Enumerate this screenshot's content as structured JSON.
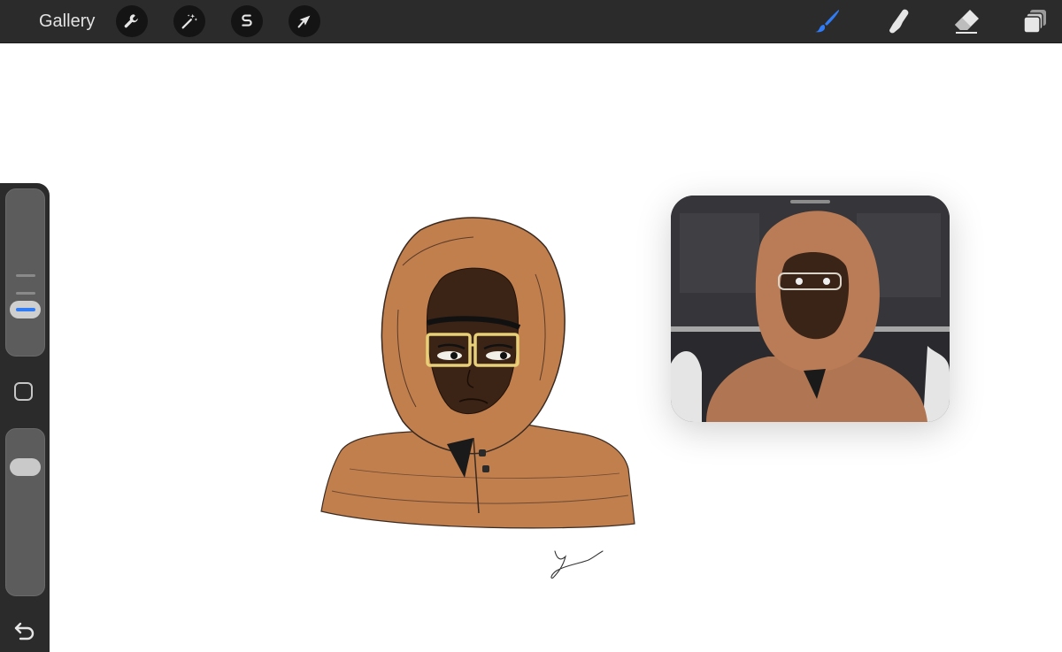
{
  "topbar": {
    "gallery_label": "Gallery",
    "left_tools": [
      {
        "name": "actions",
        "icon": "wrench-icon"
      },
      {
        "name": "adjustments",
        "icon": "magic-wand-icon"
      },
      {
        "name": "selection",
        "icon": "selection-s-icon"
      },
      {
        "name": "transform",
        "icon": "arrow-cursor-icon"
      }
    ],
    "right_tools": [
      {
        "name": "brush",
        "icon": "brush-icon",
        "active": true
      },
      {
        "name": "smudge",
        "icon": "smudge-finger-icon",
        "active": false
      },
      {
        "name": "eraser",
        "icon": "eraser-icon",
        "active": false
      },
      {
        "name": "layers",
        "icon": "layers-icon",
        "active": false
      }
    ]
  },
  "sidebar": {
    "brush_size_level": 0.32,
    "opacity_level": 0.24,
    "buttons": [
      "modify-square-icon",
      "undo-arrow-icon"
    ]
  },
  "colors": {
    "accent": "#2f7cf6",
    "toolbar": "#2b2b2b",
    "jacket": "#c17f4e",
    "skin": "#3b2416",
    "glasses": "#e8d078"
  },
  "reference": {
    "visible": true
  }
}
